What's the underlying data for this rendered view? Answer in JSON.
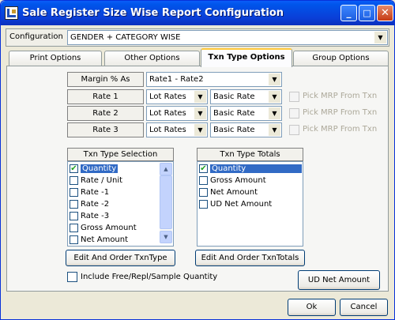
{
  "window": {
    "title": "Sale Register Size Wise Report Configuration",
    "minimize": "_",
    "maximize": "□",
    "close": "✕"
  },
  "configuration": {
    "label": "Configuration",
    "value": "GENDER + CATEGORY WISE"
  },
  "tabs": [
    "Print Options",
    "Other Options",
    "Txn Type Options",
    "Group Options"
  ],
  "margin": {
    "label": "Margin % As",
    "value": "Rate1 - Rate2"
  },
  "rates": [
    {
      "label": "Rate 1",
      "rate": "Lot Rates",
      "basis": "Basic Rate",
      "pick": "Pick MRP From Txn"
    },
    {
      "label": "Rate 2",
      "rate": "Lot Rates",
      "basis": "Basic Rate",
      "pick": "Pick MRP From Txn"
    },
    {
      "label": "Rate 3",
      "rate": "Lot Rates",
      "basis": "Basic Rate",
      "pick": "Pick MRP From Txn"
    }
  ],
  "txn_selection": {
    "header": "Txn Type Selection",
    "items": [
      {
        "label": "Quantity",
        "checked": "✔"
      },
      {
        "label": "Rate / Unit",
        "checked": ""
      },
      {
        "label": "Rate -1",
        "checked": ""
      },
      {
        "label": "Rate -2",
        "checked": ""
      },
      {
        "label": "Rate -3",
        "checked": ""
      },
      {
        "label": "Gross Amount",
        "checked": ""
      },
      {
        "label": "Net Amount",
        "checked": ""
      }
    ],
    "button": "Edit And Order TxnType"
  },
  "txn_totals": {
    "header": "Txn Type Totals",
    "items": [
      {
        "label": "Quantity",
        "checked": "✔"
      },
      {
        "label": "Gross Amount",
        "checked": ""
      },
      {
        "label": "Net Amount",
        "checked": ""
      },
      {
        "label": "UD Net Amount",
        "checked": ""
      }
    ],
    "button": "Edit And Order TxnTotals"
  },
  "include_free": {
    "label": "Include Free/Repl/Sample Quantity"
  },
  "ud_net_amount_button": "UD Net Amount",
  "footer": {
    "ok": "Ok",
    "cancel": "Cancel"
  },
  "colors": {
    "titlebar": "#0A3FD8",
    "selection": "#316AC5",
    "tab_highlight": "#FFC83C"
  },
  "icons": {
    "dropdown": "▼",
    "scroll_up": "▲",
    "scroll_down": "▼"
  }
}
